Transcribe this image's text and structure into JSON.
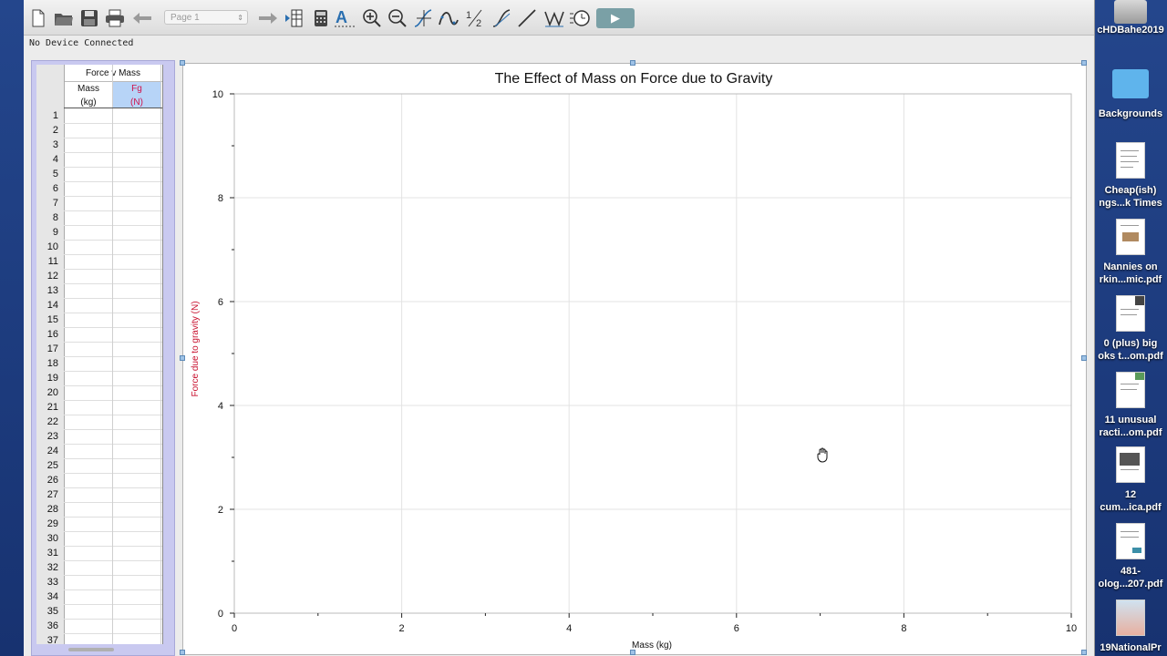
{
  "status_text": "No Device Connected",
  "toolbar": {
    "page_select": "Page 1",
    "icons": [
      "new-file-icon",
      "open-folder-icon",
      "save-icon",
      "print-icon",
      "back-arrow-icon",
      "forward-arrow-icon",
      "data-table-icon",
      "calculator-icon",
      "text-annotation-icon",
      "zoom-in-icon",
      "zoom-out-icon",
      "examine-icon",
      "curve-fit-icon",
      "integral-icon",
      "tangent-icon",
      "line-icon",
      "statistics-icon",
      "timer-icon",
      "collect-play-icon"
    ]
  },
  "data_table": {
    "dataset_title": "Force v Mass",
    "columns": [
      {
        "name": "Mass",
        "unit": "(kg)"
      },
      {
        "name": "Fg",
        "unit": "(N)"
      }
    ],
    "row_numbers": [
      1,
      2,
      3,
      4,
      5,
      6,
      7,
      8,
      9,
      10,
      11,
      12,
      13,
      14,
      15,
      16,
      17,
      18,
      19,
      20,
      21,
      22,
      23,
      24,
      25,
      26,
      27,
      28,
      29,
      30,
      31,
      32,
      33,
      34,
      35,
      36,
      37
    ]
  },
  "chart_data": {
    "type": "scatter",
    "title": "The Effect of Mass on Force due to Gravity",
    "xlabel": "Mass (kg)",
    "ylabel": "Force due to gravity (N)",
    "xlim": [
      0,
      10
    ],
    "ylim": [
      0,
      10
    ],
    "x_ticks": [
      0,
      2,
      4,
      6,
      8,
      10
    ],
    "y_ticks": [
      0,
      2,
      4,
      6,
      8,
      10
    ],
    "grid": true,
    "series": [],
    "colors": {
      "ylabel": "#c8102e",
      "grid": "#e3e3e3",
      "axis": "#222222"
    }
  },
  "desktop_icons": [
    {
      "label": "cHDBahe2019",
      "icon": "hard-drive-icon"
    },
    {
      "label": "Backgrounds",
      "icon": "folder-icon"
    },
    {
      "label": "Cheap(ish) ngs...k Times",
      "icon": "pdf-document-icon"
    },
    {
      "label": "Nannies on rkin...mic.pdf",
      "icon": "pdf-document-icon"
    },
    {
      "label": "0 (plus) big oks t...om.pdf",
      "icon": "pdf-document-icon"
    },
    {
      "label": "11 unusual racti...om.pdf",
      "icon": "pdf-document-icon"
    },
    {
      "label": "12 cum...ica.pdf",
      "icon": "pdf-document-icon"
    },
    {
      "label": "481- olog...207.pdf",
      "icon": "pdf-document-icon"
    },
    {
      "label": "19NationalPr",
      "icon": "image-document-icon"
    }
  ]
}
